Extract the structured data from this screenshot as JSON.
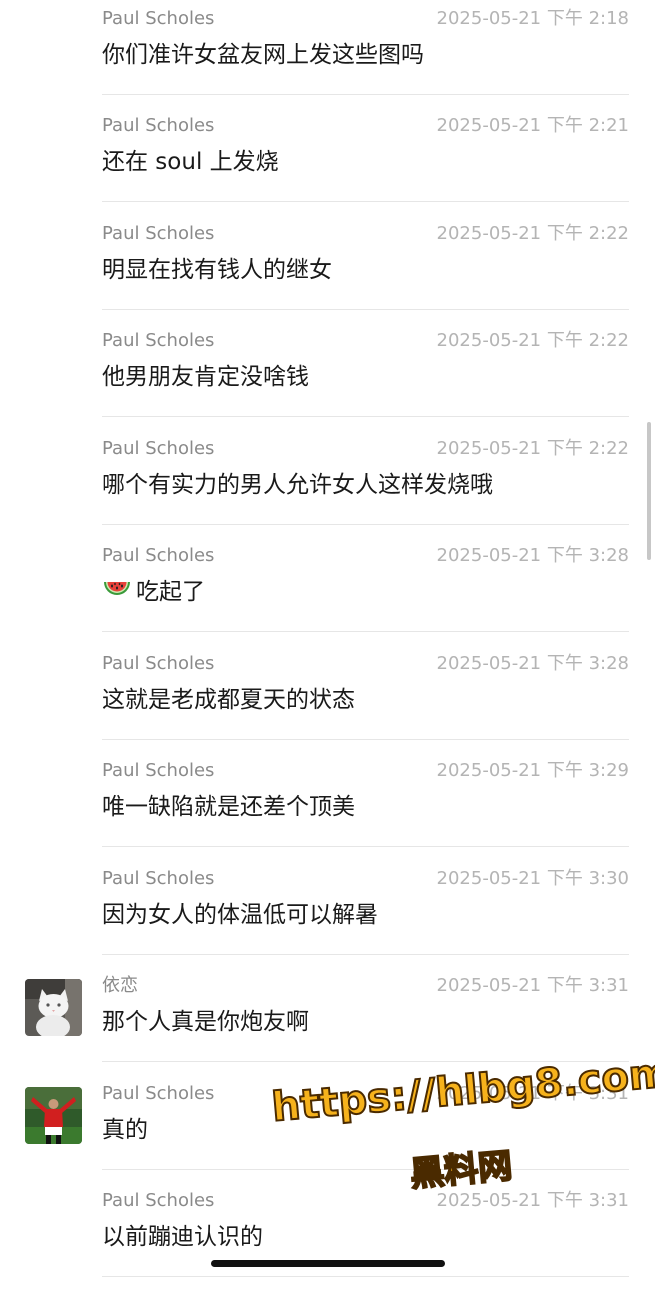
{
  "messages": [
    {
      "sender": "Paul Scholes",
      "time": "2025-05-21 下午 2:18",
      "text": "你们准许女盆友网上发这些图吗",
      "avatar": "none"
    },
    {
      "sender": "Paul Scholes",
      "time": "2025-05-21 下午 2:21",
      "text": "还在 soul 上发烧",
      "avatar": "none"
    },
    {
      "sender": "Paul Scholes",
      "time": "2025-05-21 下午 2:22",
      "text": "明显在找有钱人的继女",
      "avatar": "none"
    },
    {
      "sender": "Paul Scholes",
      "time": "2025-05-21 下午 2:22",
      "text": "他男朋友肯定没啥钱",
      "avatar": "none"
    },
    {
      "sender": "Paul Scholes",
      "time": "2025-05-21 下午 2:22",
      "text": "哪个有实力的男人允许女人这样发烧哦",
      "avatar": "none"
    },
    {
      "sender": "Paul Scholes",
      "time": "2025-05-21 下午 3:28",
      "text": "吃起了",
      "avatar": "none",
      "emoji": "watermelon-icon"
    },
    {
      "sender": "Paul Scholes",
      "time": "2025-05-21 下午 3:28",
      "text": "这就是老成都夏天的状态",
      "avatar": "none"
    },
    {
      "sender": "Paul Scholes",
      "time": "2025-05-21 下午 3:29",
      "text": "唯一缺陷就是还差个顶美",
      "avatar": "none"
    },
    {
      "sender": "Paul Scholes",
      "time": "2025-05-21 下午 3:30",
      "text": "因为女人的体温低可以解暑",
      "avatar": "none"
    },
    {
      "sender": "依恋",
      "time": "2025-05-21 下午 3:31",
      "text": "那个人真是你炮友啊",
      "avatar": "cat-avatar"
    },
    {
      "sender": "Paul Scholes",
      "time": "2025-05-21 下午 3:31",
      "text": "真的",
      "avatar": "footballer-avatar"
    },
    {
      "sender": "Paul Scholes",
      "time": "2025-05-21 下午 3:31",
      "text": "以前蹦迪认识的",
      "avatar": "none"
    }
  ],
  "watermark": {
    "url": "https://hlbg8.com",
    "text": "黑料网"
  },
  "colors": {
    "sender": "#8a8a8a",
    "time": "#b4b4b4",
    "message": "#1a1a1a",
    "divider": "#e6e6e6",
    "watermark_fill": "#f6b21c"
  }
}
